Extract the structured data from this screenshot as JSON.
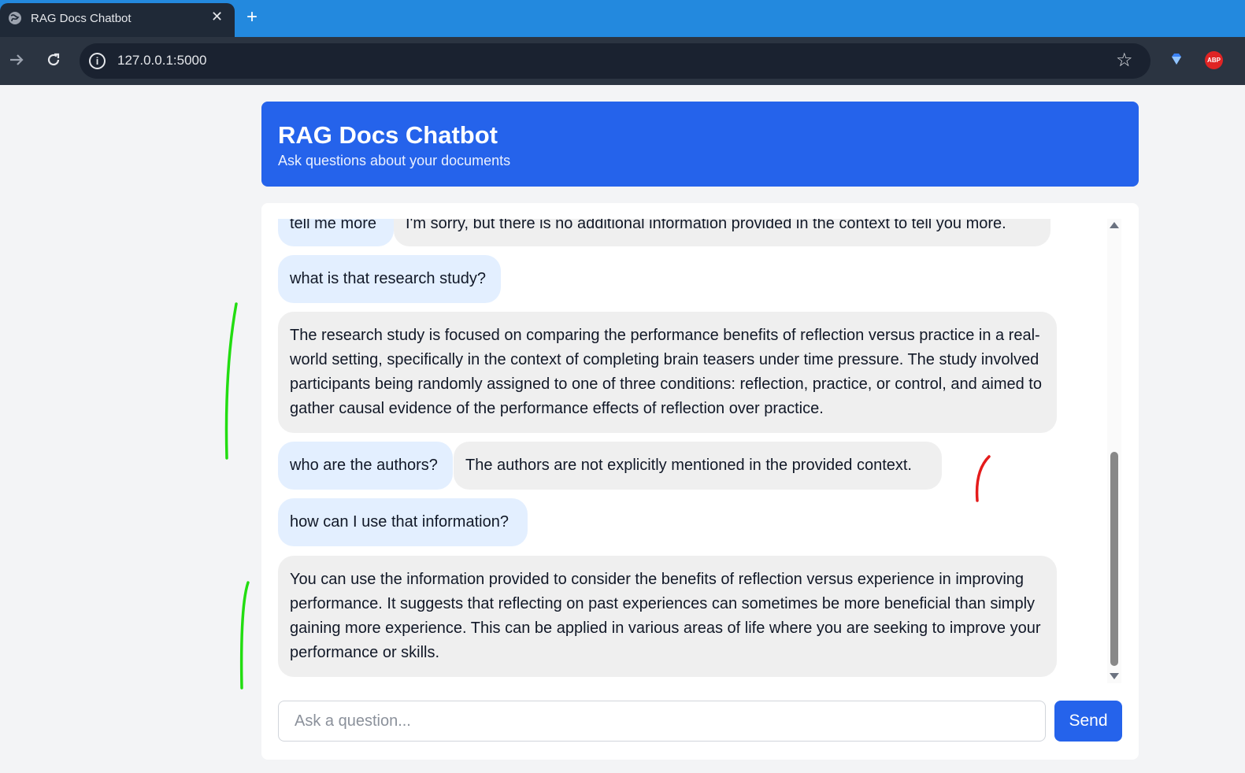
{
  "browser": {
    "tab_title": "RAG Docs Chatbot",
    "tab_close": "✕",
    "new_tab": "+",
    "url": "127.0.0.1:5000",
    "ext_abp": "ABP",
    "info_glyph": "i",
    "star_glyph": "☆"
  },
  "app": {
    "title": "RAG Docs Chatbot",
    "subtitle": "Ask questions about your documents"
  },
  "messages": [
    {
      "role": "user",
      "text": "tell me more"
    },
    {
      "role": "bot",
      "text": "I'm sorry, but there is no additional information provided in the context to tell you more."
    },
    {
      "role": "user",
      "text": "what is that research study?"
    },
    {
      "role": "bot",
      "text": "The research study is focused on comparing the performance benefits of reflection versus practice in a real-world setting, specifically in the context of completing brain teasers under time pressure. The study involved participants being randomly assigned to one of three conditions: reflection, practice, or control, and aimed to gather causal evidence of the performance effects of reflection over practice."
    },
    {
      "role": "user",
      "text": "who are the authors?"
    },
    {
      "role": "bot",
      "text": "The authors are not explicitly mentioned in the provided context."
    },
    {
      "role": "user",
      "text": "how can I use that information?"
    },
    {
      "role": "bot",
      "text": "You can use the information provided to consider the benefits of reflection versus experience in improving performance. It suggests that reflecting on past experiences can sometimes be more beneficial than simply gaining more experience. This can be applied in various areas of life where you are seeking to improve your performance or skills."
    }
  ],
  "input": {
    "placeholder": "Ask a question...",
    "value": ""
  },
  "send_label": "Send",
  "colors": {
    "accent": "#2563eb",
    "user_bubble": "#e3efff",
    "bot_bubble": "#efefef"
  },
  "icons": [
    "globe-icon",
    "close-icon",
    "plus-icon",
    "forward-icon",
    "reload-icon",
    "info-icon",
    "star-icon",
    "gem-extension-icon",
    "adblock-icon"
  ]
}
